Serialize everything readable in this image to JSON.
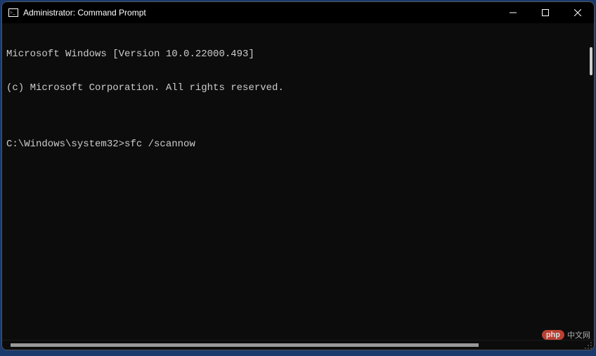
{
  "window": {
    "title": "Administrator: Command Prompt"
  },
  "terminal": {
    "lines": [
      "Microsoft Windows [Version 10.0.22000.493]",
      "(c) Microsoft Corporation. All rights reserved.",
      "",
      "C:\\Windows\\system32>sfc /scannow"
    ],
    "prompt_path": "C:\\Windows\\system32>",
    "current_command": "sfc /scannow"
  },
  "watermark": {
    "badge": "php",
    "text": "中文网"
  }
}
